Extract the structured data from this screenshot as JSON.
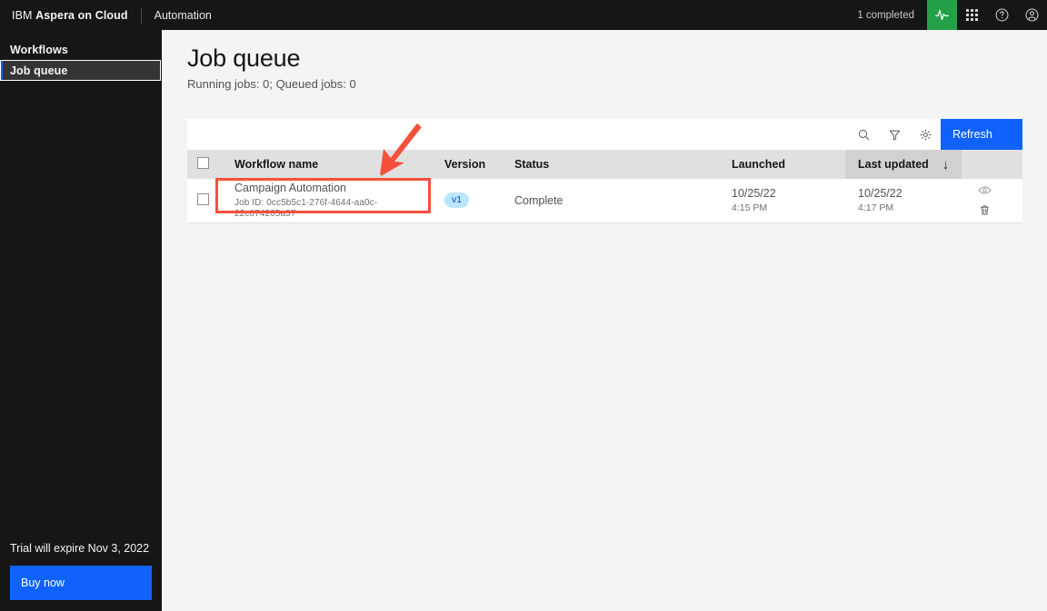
{
  "topbar": {
    "brand_prefix": "IBM",
    "brand_name": "Aspera on Cloud",
    "app_name": "Automation",
    "completed_status": "1 completed",
    "icons": {
      "activity": "activity-icon",
      "app_switcher": "app-switcher-grid-icon",
      "help": "help-circle-icon",
      "account": "user-avatar-icon"
    },
    "colors": {
      "background": "#161616",
      "activity_tile": "#24a148"
    }
  },
  "sidebar": {
    "items": [
      {
        "label": "Workflows",
        "selected": false
      },
      {
        "label": "Job queue",
        "selected": true
      }
    ],
    "trial_notice": "Trial will expire Nov 3, 2022",
    "buy_label": "Buy now",
    "colors": {
      "background": "#161616",
      "selected_bg": "#353535",
      "accent": "#0f62fe"
    }
  },
  "page": {
    "title": "Job queue",
    "subtitle": "Running jobs: 0; Queued jobs: 0"
  },
  "toolbar": {
    "search_icon": "search-icon",
    "filter_icon": "filter-funnel-icon",
    "settings_icon": "settings-gear-icon",
    "refresh_label": "Refresh",
    "refresh_color": "#0f62fe"
  },
  "table": {
    "columns": [
      {
        "key": "select",
        "label": ""
      },
      {
        "key": "name",
        "label": "Workflow name"
      },
      {
        "key": "version",
        "label": "Version"
      },
      {
        "key": "status",
        "label": "Status"
      },
      {
        "key": "launched",
        "label": "Launched"
      },
      {
        "key": "updated",
        "label": "Last updated"
      },
      {
        "key": "actions",
        "label": ""
      }
    ],
    "sort": {
      "column": "Last updated",
      "direction": "descending",
      "glyph": "↓"
    },
    "rows": [
      {
        "name": "Campaign Automation",
        "job_id": "Job ID: 0cc5b5c1-276f-4644-aa0c-22c074205a37",
        "version": "v1",
        "status": "Complete",
        "launched_date": "10/25/22",
        "launched_time": "4:15 PM",
        "updated_date": "10/25/22",
        "updated_time": "4:17 PM",
        "actions": {
          "view": "eye-view-icon",
          "delete": "trash-delete-icon"
        }
      }
    ]
  },
  "annotations": {
    "highlight_color": "#f4503c",
    "box_target": "workflow-name-cell",
    "arrow_target": "workflow-name-cell"
  }
}
